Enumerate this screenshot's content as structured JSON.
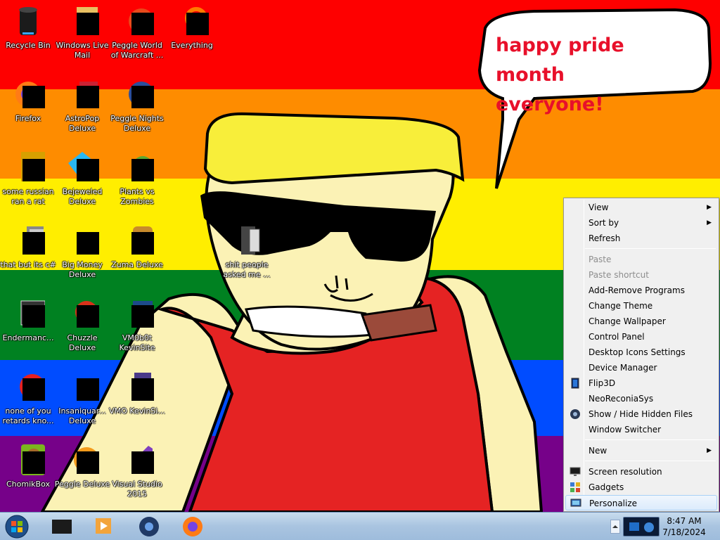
{
  "bubble": {
    "line1": "happy pride month",
    "line2": "everyone!"
  },
  "desktop_icons": [
    {
      "label": "Recycle Bin"
    },
    {
      "label": "Windows Live Mail"
    },
    {
      "label": "Peggle World of Warcraft ..."
    },
    {
      "label": "Everything"
    },
    {
      "label": "Firefox"
    },
    {
      "label": "AstroPop Deluxe"
    },
    {
      "label": "Peggle Nights Deluxe"
    },
    {
      "label": "some russian ran a rat"
    },
    {
      "label": "Bejeweled Deluxe"
    },
    {
      "label": "Plants vs Zombies"
    },
    {
      "label": "that but its c#"
    },
    {
      "label": "Big Money Deluxe"
    },
    {
      "label": "Zuma Deluxe"
    },
    {
      "label": "shit people asked me ..."
    },
    {
      "label": "Endermanc..."
    },
    {
      "label": "Chuzzle Deluxe"
    },
    {
      "label": "VM0b0t KevinSite"
    },
    {
      "label": "none of you retards kno..."
    },
    {
      "label": "Insaniquar... Deluxe"
    },
    {
      "label": "VMO KevinSi..."
    },
    {
      "label": "ChomikBox"
    },
    {
      "label": "Peggle Deluxe"
    },
    {
      "label": "Visual Studio 2015"
    }
  ],
  "context_menu": {
    "view": "View",
    "sort_by": "Sort by",
    "refresh": "Refresh",
    "paste": "Paste",
    "paste_shortcut": "Paste shortcut",
    "add_remove": "Add-Remove Programs",
    "change_theme": "Change Theme",
    "change_wallpaper": "Change Wallpaper",
    "control_panel": "Control Panel",
    "desktop_icons_settings": "Desktop Icons Settings",
    "device_manager": "Device Manager",
    "flip3d": "Flip3D",
    "neoreconia": "NeoReconiaSys",
    "show_hide": "Show / Hide Hidden Files",
    "window_switcher": "Window Switcher",
    "new": "New",
    "screen_resolution": "Screen resolution",
    "gadgets": "Gadgets",
    "personalize": "Personalize",
    "submenu_arrow": "▶"
  },
  "taskbar": {
    "time": "8:47 AM",
    "date": "7/18/2024"
  },
  "colors": {
    "red": "#fe0000",
    "orange": "#fe8c00",
    "yellow": "#ffee00",
    "green": "#008121",
    "blue": "#004cff",
    "purple": "#760189",
    "bubble_text": "#e8102a"
  }
}
